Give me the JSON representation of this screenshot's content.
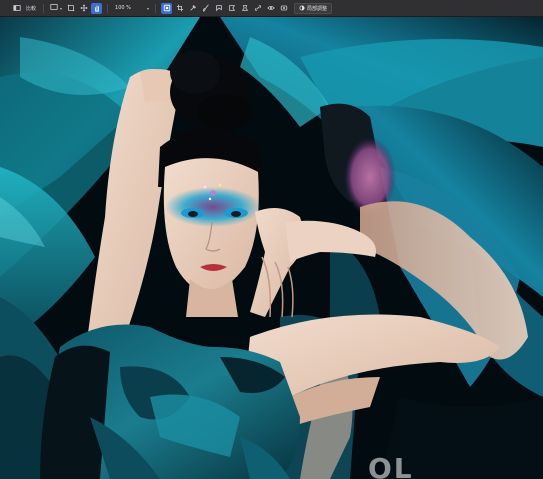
{
  "toolbar": {
    "compare_label": "比較",
    "zoom_value": "100 %",
    "adjust_label": "局部調整",
    "icons": [
      "layout-icon",
      "frame-icon",
      "dropdown-caret-icon",
      "crop-icon",
      "move-icon",
      "hand-icon",
      "preview-toggle-icon",
      "crop-ratio-icon",
      "eyedropper-icon",
      "brush-icon",
      "lasso-icon",
      "polygon-lasso-icon",
      "stamp-icon",
      "link-icon",
      "eye-icon",
      "record-icon"
    ]
  },
  "photo": {
    "subject": "portrait of a woman with teal fabric and glitter eye makeup",
    "watermark_text": "OL"
  },
  "colors": {
    "toolbar_bg": "#303032",
    "accent": "#3b6fd4",
    "teal": "#1f8fa0"
  }
}
